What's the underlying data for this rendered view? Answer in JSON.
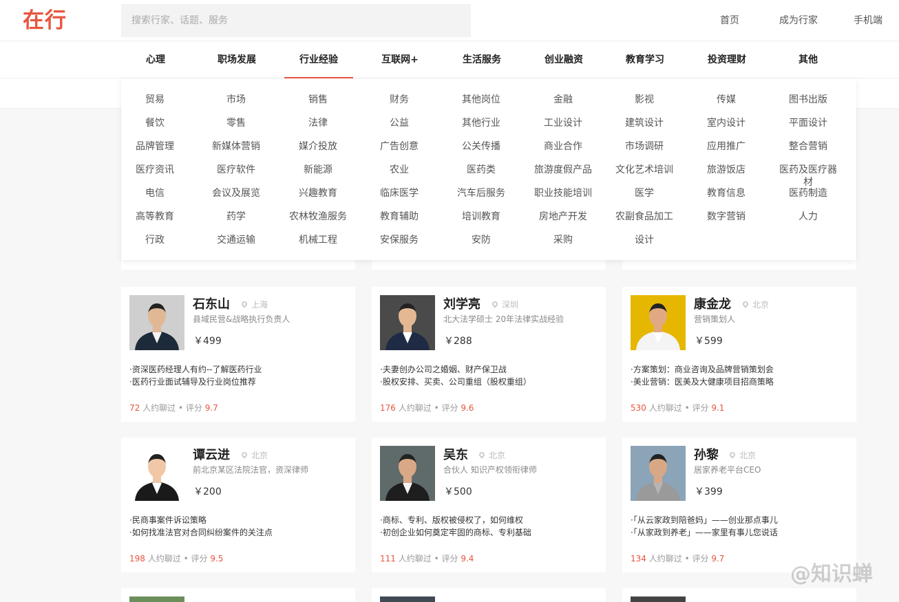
{
  "header": {
    "logo": "在行",
    "search_placeholder": "搜索行家、话题、服务",
    "nav": [
      "首页",
      "成为行家",
      "手机端"
    ]
  },
  "categories": [
    "心理",
    "职场发展",
    "行业经验",
    "互联网+",
    "生活服务",
    "创业融资",
    "教育学习",
    "投资理财",
    "其他"
  ],
  "active_category": "行业经验",
  "subcategories": [
    [
      "贸易",
      "市场",
      "销售",
      "财务",
      "其他岗位",
      "金融",
      "影视",
      "传媒",
      "图书出版"
    ],
    [
      "餐饮",
      "零售",
      "法律",
      "公益",
      "其他行业",
      "工业设计",
      "建筑设计",
      "室内设计",
      "平面设计"
    ],
    [
      "品牌管理",
      "新媒体营销",
      "媒介投放",
      "广告创意",
      "公关传播",
      "商业合作",
      "市场调研",
      "应用推广",
      "整合营销"
    ],
    [
      "医疗资讯",
      "医疗软件",
      "新能源",
      "农业",
      "医药类",
      "旅游度假产品",
      "文化艺术培训",
      "旅游饭店",
      "医药及医疗器材"
    ],
    [
      "电信",
      "会议及展览",
      "兴趣教育",
      "临床医学",
      "汽车后服务",
      "职业技能培训",
      "医学",
      "教育信息",
      "医药制造"
    ],
    [
      "高等教育",
      "药学",
      "农林牧渔服务",
      "教育辅助",
      "培训教育",
      "房地产开发",
      "农副食品加工",
      "数字营销",
      "人力"
    ],
    [
      "行政",
      "交通运输",
      "机械工程",
      "安保服务",
      "安防",
      "采购",
      "设计"
    ]
  ],
  "stats_labels": {
    "people": "人约聊过",
    "score": "评分"
  },
  "experts": [
    {
      "name": "石东山",
      "city": "上海",
      "title": "县域民营&战略执行负责人",
      "price": "￥499",
      "topics": [
        "·资深医药经理人有约--了解医药行业",
        "·医药行业面试辅导及行业岗位推荐"
      ],
      "count": "72",
      "rating": "9.7"
    },
    {
      "name": "刘学亮",
      "city": "深圳",
      "title": "北大法学硕士 20年法律实战经验",
      "price": "￥288",
      "topics": [
        "·夫妻创办公司之婚姻、财产保卫战",
        "·股权安排、买卖、公司重组（股权重组）"
      ],
      "count": "176",
      "rating": "9.6"
    },
    {
      "name": "康金龙",
      "city": "北京",
      "title": "营销策划人",
      "price": "￥599",
      "topics": [
        "·方案策划：商业咨询及品牌营销策划会",
        "·美业营销：医美及大健康项目招商策略"
      ],
      "count": "530",
      "rating": "9.1"
    },
    {
      "name": "谭云进",
      "city": "北京",
      "title": "前北京某区法院法官，资深律师",
      "price": "￥200",
      "topics": [
        "·民商事案件诉讼策略",
        "·如何找准法官对合同纠纷案件的关注点"
      ],
      "count": "198",
      "rating": "9.5"
    },
    {
      "name": "吴东",
      "city": "北京",
      "title": "合伙人 知识产权领衔律师",
      "price": "￥500",
      "topics": [
        "·商标、专利、版权被侵权了，如何维权",
        "·初创企业如何奠定牢固的商标、专利基础"
      ],
      "count": "111",
      "rating": "9.4"
    },
    {
      "name": "孙黎",
      "city": "北京",
      "title": "居家养老平台CEO",
      "price": "￥399",
      "topics": [
        "·「从云家政到陪爸妈」——创业那点事儿",
        "·「从家政到养老」——家里有事儿您说话"
      ],
      "count": "134",
      "rating": "9.7"
    }
  ],
  "colors": {
    "accent": "#e8553e",
    "background": "#f7f7f7"
  },
  "watermark": "@知识蝉"
}
